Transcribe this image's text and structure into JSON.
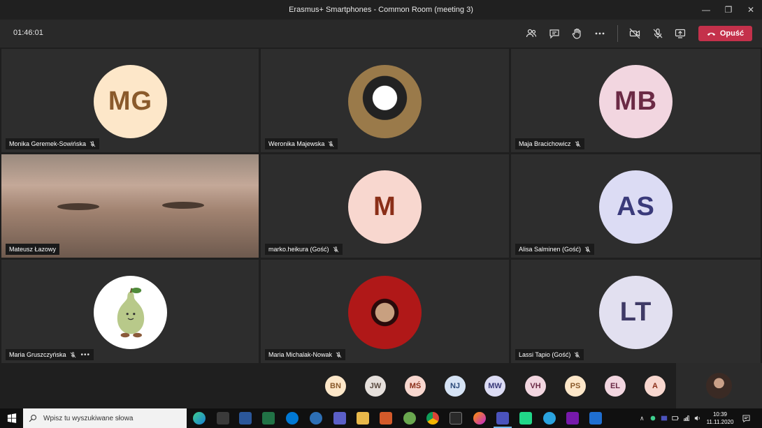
{
  "window": {
    "title": "Erasmus+ Smartphones - Common Room (meeting 3)",
    "controls": [
      "—",
      "❐",
      "✕"
    ]
  },
  "toolbar": {
    "timer": "01:46:01",
    "leave_label": "Opuść",
    "icons": [
      "participants-icon",
      "chat-icon",
      "raise-hand-icon",
      "more-options-icon",
      "camera-off-icon",
      "mic-muted-icon",
      "share-screen-icon"
    ]
  },
  "participants": [
    {
      "name": "Monika Geremek-Sowińska",
      "initials": "MG",
      "bg": "#fde7c9",
      "fg": "#8a5a2b",
      "avatar_type": "initials",
      "muted": true
    },
    {
      "name": "Weronika Majewska",
      "initials": "",
      "avatar_type": "photo-cat",
      "muted": true
    },
    {
      "name": "Maja Bracichowicz",
      "initials": "MB",
      "bg": "#f2d6e0",
      "fg": "#6b2a45",
      "avatar_type": "initials",
      "muted": true
    },
    {
      "name": "Mateusz Łazowy",
      "initials": "",
      "avatar_type": "video",
      "muted": false
    },
    {
      "name": "marko.heikura (Gość)",
      "initials": "M",
      "bg": "#f8d7cf",
      "fg": "#8a2e18",
      "avatar_type": "initials",
      "muted": true
    },
    {
      "name": "Alisa Salminen (Gość)",
      "initials": "AS",
      "bg": "#dcdcf4",
      "fg": "#3a3a7a",
      "avatar_type": "initials",
      "muted": true
    },
    {
      "name": "Maria Gruszczyńska",
      "initials": "",
      "avatar_type": "photo-pear",
      "muted": true,
      "more": "•••"
    },
    {
      "name": "Maria Michalak-Nowak",
      "initials": "",
      "avatar_type": "photo-red",
      "muted": true
    },
    {
      "name": "Lassi Tapio (Gość)",
      "initials": "LT",
      "bg": "#e2e0f0",
      "fg": "#3f3a66",
      "avatar_type": "initials",
      "muted": true
    }
  ],
  "strip": [
    {
      "initials": "BN",
      "bg": "#fde7c9",
      "fg": "#8a5a2b"
    },
    {
      "initials": "JW",
      "bg": "#e6e0dc",
      "fg": "#5a4a40"
    },
    {
      "initials": "MŚ",
      "bg": "#f8d7cf",
      "fg": "#8a2e18"
    },
    {
      "initials": "NJ",
      "bg": "#d6e3f5",
      "fg": "#2b4a7a"
    },
    {
      "initials": "MW",
      "bg": "#dcdcf4",
      "fg": "#3a3a7a"
    },
    {
      "initials": "VH",
      "bg": "#f2d6e0",
      "fg": "#6b2a45"
    },
    {
      "initials": "PS",
      "bg": "#fde7c9",
      "fg": "#8a5a2b"
    },
    {
      "initials": "EL",
      "bg": "#f2d6e0",
      "fg": "#6b2a45"
    },
    {
      "initials": "A",
      "bg": "#f8d7cf",
      "fg": "#8a2e18"
    }
  ],
  "taskbar": {
    "search_placeholder": "Wpisz tu wyszukiwane słowa",
    "time": "10:39",
    "date": "11.11.2020",
    "tray_chevron": "∧"
  }
}
